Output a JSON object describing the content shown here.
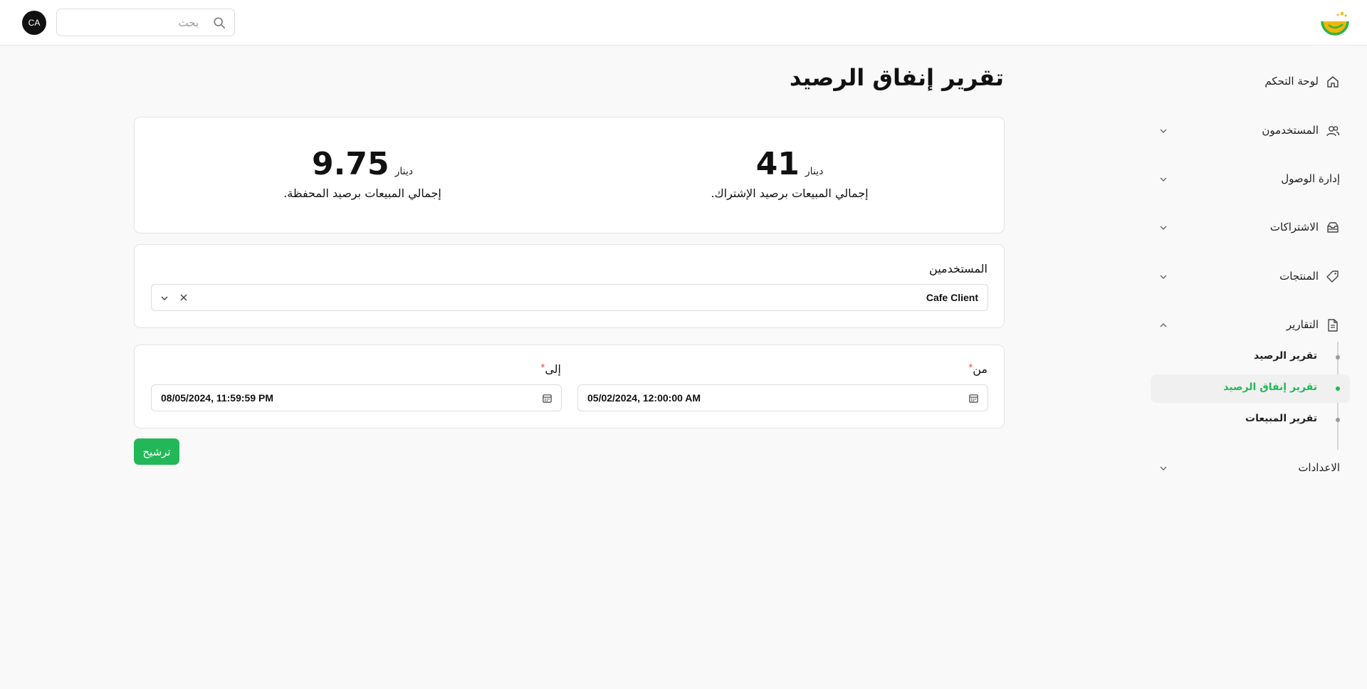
{
  "header": {
    "search_placeholder": "بحث",
    "avatar_initials": "CA"
  },
  "sidebar": {
    "items": [
      {
        "label": "لوحة التحكم",
        "icon": "home-icon"
      },
      {
        "label": "المستخدمون",
        "icon": "users-icon"
      },
      {
        "label": "إدارة الوصول",
        "icon": ""
      },
      {
        "label": "الاشتراكات",
        "icon": "inbox-icon"
      },
      {
        "label": "المنتجات",
        "icon": "tag-icon"
      },
      {
        "label": "التقارير",
        "icon": "file-icon"
      },
      {
        "label": "الاعدادات",
        "icon": ""
      }
    ],
    "report_sub_items": [
      {
        "label": "تقرير الرصيد"
      },
      {
        "label": "تقرير إنفاق الرصيد"
      },
      {
        "label": "تقرير المبيعات"
      }
    ],
    "active_sub_item": "تقرير إنفاق الرصيد"
  },
  "main": {
    "title": "تقرير إنفاق الرصيد",
    "stats": [
      {
        "value": "41",
        "unit": "دينار",
        "caption": "إجمالي المبيعات برصيد الإشتراك."
      },
      {
        "value": "9.75",
        "unit": "دينار",
        "caption": "إجمالي المبيعات برصيد المحفظة."
      }
    ],
    "users_field": {
      "label": "المستخدمين",
      "value": "Cafe Client"
    },
    "from_field": {
      "label": "من",
      "required_mark": "*",
      "value": "05/02/2024, 12:00:00 AM"
    },
    "to_field": {
      "label": "إلى",
      "required_mark": "*",
      "value": "08/05/2024, 11:59:59 PM"
    },
    "filter_button": "ترشيح"
  },
  "colors": {
    "accent": "#22b858",
    "logo_yellow": "#f2b705",
    "logo_green": "#2db34a",
    "required": "#e0453a"
  }
}
